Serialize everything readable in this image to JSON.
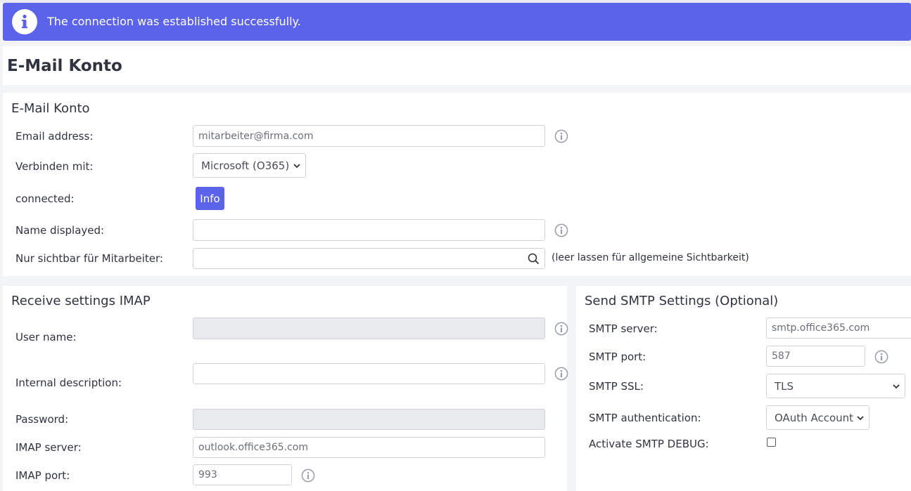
{
  "alert": {
    "message": "The connection was established successfully."
  },
  "page": {
    "title": "E-Mail Konto"
  },
  "account": {
    "title": "E-Mail Konto",
    "email_label": "Email address:",
    "email_value": "mitarbeiter@firma.com",
    "connect_label": "Verbinden mit:",
    "connect_value": "Microsoft (O365)",
    "connected_label": "connected:",
    "info_button": "Info",
    "name_label": "Name displayed:",
    "name_value": "",
    "visible_label": "Nur sichtbar für Mitarbeiter:",
    "visible_value": "",
    "visible_hint": "(leer lassen für allgemeine Sichtbarkeit)"
  },
  "imap": {
    "title": "Receive settings IMAP",
    "user_label": "User name:",
    "user_value": "",
    "desc_label": "Internal description:",
    "desc_value": "",
    "password_label": "Password:",
    "password_value": "",
    "server_label": "IMAP server:",
    "server_value": "outlook.office365.com",
    "port_label": "IMAP port:",
    "port_value": "993"
  },
  "smtp": {
    "title": "Send SMTP Settings (Optional)",
    "server_label": "SMTP server:",
    "server_value": "smtp.office365.com",
    "port_label": "SMTP port:",
    "port_value": "587",
    "ssl_label": "SMTP SSL:",
    "ssl_value": "TLS",
    "auth_label": "SMTP authentication:",
    "auth_value": "OAuth Account",
    "debug_label": "Activate SMTP DEBUG:",
    "debug_checked": false
  },
  "colors": {
    "accent": "#5a63ea",
    "background": "#f3f4f6",
    "panel": "#ffffff",
    "disabled_input": "#e9eaee",
    "info_icon": "#9a9ea6"
  },
  "icons": {
    "alert": "info-circle-icon",
    "help": "info-outline-icon",
    "search": "search-icon",
    "dropdown": "chevron-down-icon"
  }
}
